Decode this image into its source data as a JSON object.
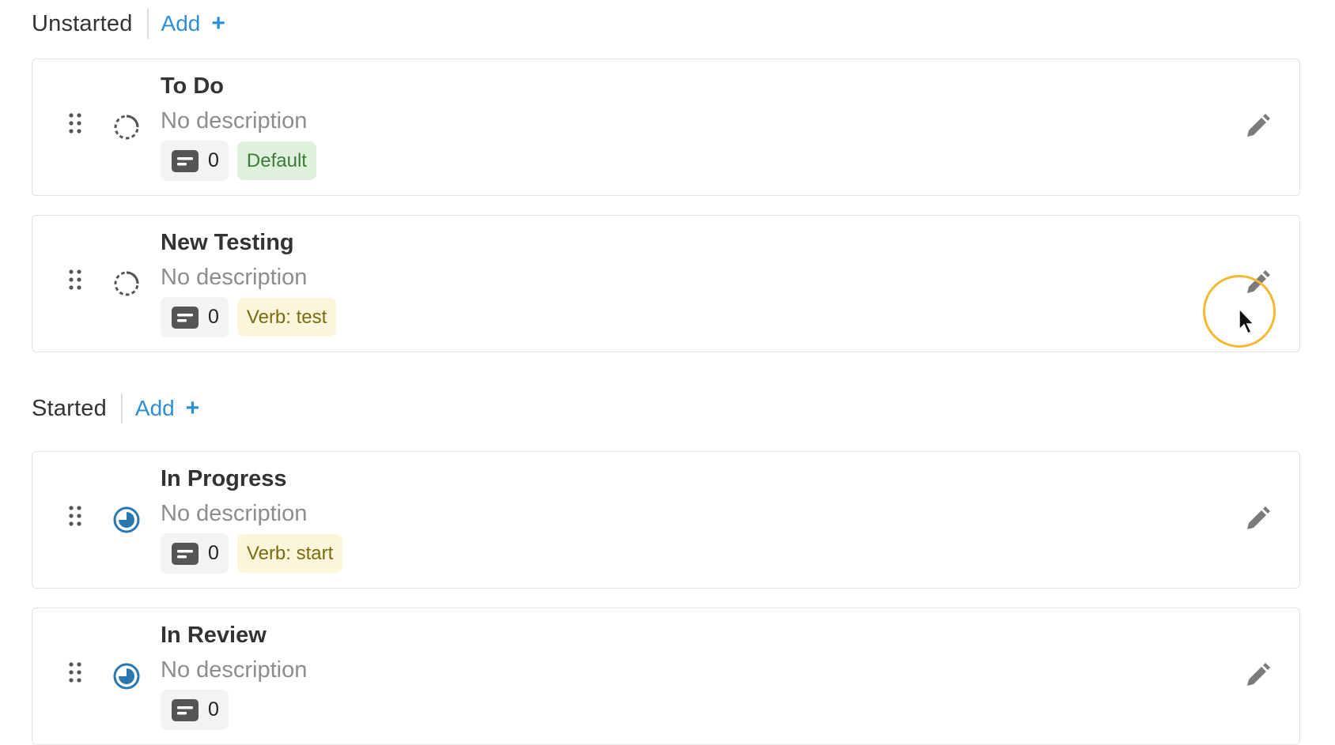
{
  "sections": [
    {
      "title": "Unstarted",
      "add_label": "Add",
      "add_symbol": "+",
      "cards": [
        {
          "title": "To Do",
          "description": "No description",
          "count": "0",
          "tag": "Default",
          "tag_color": "green",
          "status_icon": "dashed-circle-icon"
        },
        {
          "title": "New Testing",
          "description": "No description",
          "count": "0",
          "tag": "Verb: test",
          "tag_color": "yellow",
          "status_icon": "dashed-circle-icon"
        }
      ]
    },
    {
      "title": "Started",
      "add_label": "Add",
      "add_symbol": "+",
      "cards": [
        {
          "title": "In Progress",
          "description": "No description",
          "count": "0",
          "tag": "Verb: start",
          "tag_color": "yellow",
          "status_icon": "progress-circle-icon"
        },
        {
          "title": "In Review",
          "description": "No description",
          "count": "0",
          "tag": "",
          "tag_color": "",
          "status_icon": "progress-circle-icon"
        }
      ]
    }
  ],
  "colors": {
    "accent": "#2d8fd5",
    "status_started": "#2a78b0",
    "status_unstarted": "#555555",
    "tag_green_bg": "#dff0dd",
    "tag_yellow_bg": "#fcf7dc",
    "cursor_highlight": "#f5b82e"
  }
}
